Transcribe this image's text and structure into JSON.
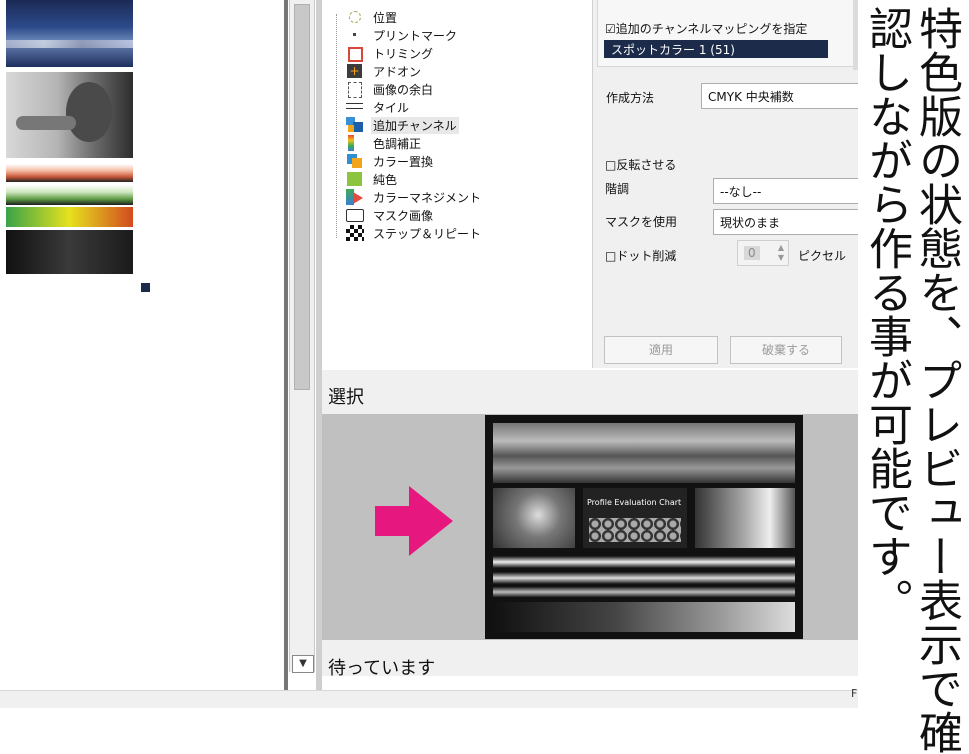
{
  "tree": {
    "items": [
      {
        "label": "位置",
        "icon": "position-icon"
      },
      {
        "label": "プリントマーク",
        "icon": "print-mark-icon"
      },
      {
        "label": "トリミング",
        "icon": "crop-icon"
      },
      {
        "label": "アドオン",
        "icon": "addon-icon"
      },
      {
        "label": "画像の余白",
        "icon": "margin-icon"
      },
      {
        "label": "タイル",
        "icon": "tile-icon"
      },
      {
        "label": "追加チャンネル",
        "icon": "extra-channel-icon"
      },
      {
        "label": "色調補正",
        "icon": "color-correction-icon"
      },
      {
        "label": "カラー置換",
        "icon": "color-replace-icon"
      },
      {
        "label": "純色",
        "icon": "pure-color-icon"
      },
      {
        "label": "カラーマネジメント",
        "icon": "color-management-icon"
      },
      {
        "label": "マスク画像",
        "icon": "mask-image-icon"
      },
      {
        "label": "ステップ＆リピート",
        "icon": "step-repeat-icon"
      }
    ]
  },
  "settings": {
    "mapping_checkbox": "☑追加のチャンネルマッピングを指定",
    "spot_item": "スポットカラー 1 (51)",
    "method_label": "作成方法",
    "method_value": "CMYK 中央補数",
    "invert_checkbox": "□反転させる",
    "gradation_label": "階調",
    "gradation_value": "--なし--",
    "mask_label": "マスクを使用",
    "mask_value": "現状のまま",
    "dot_checkbox": "□ドット削減",
    "dot_value": "0",
    "dot_unit": "ピクセル",
    "apply_button": "適用",
    "discard_button": "破棄する"
  },
  "select": {
    "header": "選択",
    "preview_chart_title": "Profile Evaluation Chart"
  },
  "status": {
    "waiting": "待っています",
    "corner": "F"
  },
  "overlay": {
    "col1": "特色版の状態を、プレビュー表示で確",
    "col2": "認しながら作る事が可能です。"
  },
  "colors": {
    "arrow": "#e6177f",
    "spot_selected": "#1c2b4a"
  }
}
